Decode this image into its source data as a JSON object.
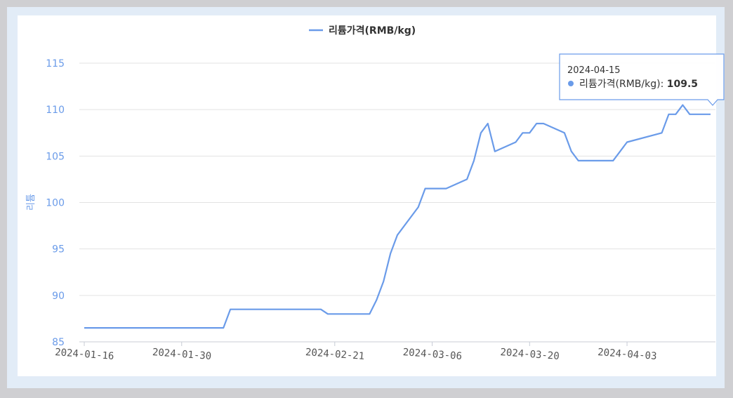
{
  "chart_data": {
    "type": "line",
    "title": "",
    "xlabel": "",
    "ylabel": "리튬",
    "ylim": [
      85,
      115
    ],
    "yticks": [
      "85",
      "90",
      "95",
      "100",
      "105",
      "110",
      "115"
    ],
    "xticks": [
      "2024-01-16",
      "2024-01-30",
      "2024-02-21",
      "2024-03-06",
      "2024-03-20",
      "2024-04-03"
    ],
    "grid": true,
    "legend_position": "top-center",
    "series": [
      {
        "name": "리튬가격(RMB/kg)",
        "color": "#6a9be9",
        "x": [
          "2024-01-16",
          "2024-01-17",
          "2024-01-18",
          "2024-01-19",
          "2024-01-22",
          "2024-01-23",
          "2024-01-24",
          "2024-01-25",
          "2024-01-26",
          "2024-01-29",
          "2024-01-30",
          "2024-01-31",
          "2024-02-01",
          "2024-02-02",
          "2024-02-05",
          "2024-02-06",
          "2024-02-07",
          "2024-02-08",
          "2024-02-19",
          "2024-02-20",
          "2024-02-21",
          "2024-02-22",
          "2024-02-23",
          "2024-02-26",
          "2024-02-27",
          "2024-02-28",
          "2024-02-29",
          "2024-03-01",
          "2024-03-04",
          "2024-03-05",
          "2024-03-06",
          "2024-03-07",
          "2024-03-08",
          "2024-03-11",
          "2024-03-12",
          "2024-03-13",
          "2024-03-14",
          "2024-03-15",
          "2024-03-18",
          "2024-03-19",
          "2024-03-20",
          "2024-03-21",
          "2024-03-22",
          "2024-03-25",
          "2024-03-26",
          "2024-03-27",
          "2024-03-28",
          "2024-03-29",
          "2024-04-01",
          "2024-04-02",
          "2024-04-03",
          "2024-04-08",
          "2024-04-09",
          "2024-04-10",
          "2024-04-11",
          "2024-04-12",
          "2024-04-15"
        ],
        "values": [
          86.5,
          86.5,
          86.5,
          86.5,
          86.5,
          86.5,
          86.5,
          86.5,
          86.5,
          86.5,
          86.5,
          86.5,
          86.5,
          86.5,
          86.5,
          88.5,
          88.5,
          88.5,
          88.5,
          88.0,
          88.0,
          88.0,
          88.0,
          88.0,
          89.5,
          91.5,
          94.5,
          96.5,
          99.5,
          101.5,
          101.5,
          101.5,
          101.5,
          102.5,
          104.5,
          107.5,
          108.5,
          105.5,
          106.5,
          107.5,
          107.5,
          108.5,
          108.5,
          107.5,
          105.5,
          104.5,
          104.5,
          104.5,
          104.5,
          105.5,
          106.5,
          107.5,
          109.5,
          109.5,
          110.5,
          109.5,
          109.5
        ]
      }
    ],
    "tooltip": {
      "date": "2024-04-15",
      "series_label": "리튬가격(RMB/kg)",
      "value": "109.5"
    }
  }
}
